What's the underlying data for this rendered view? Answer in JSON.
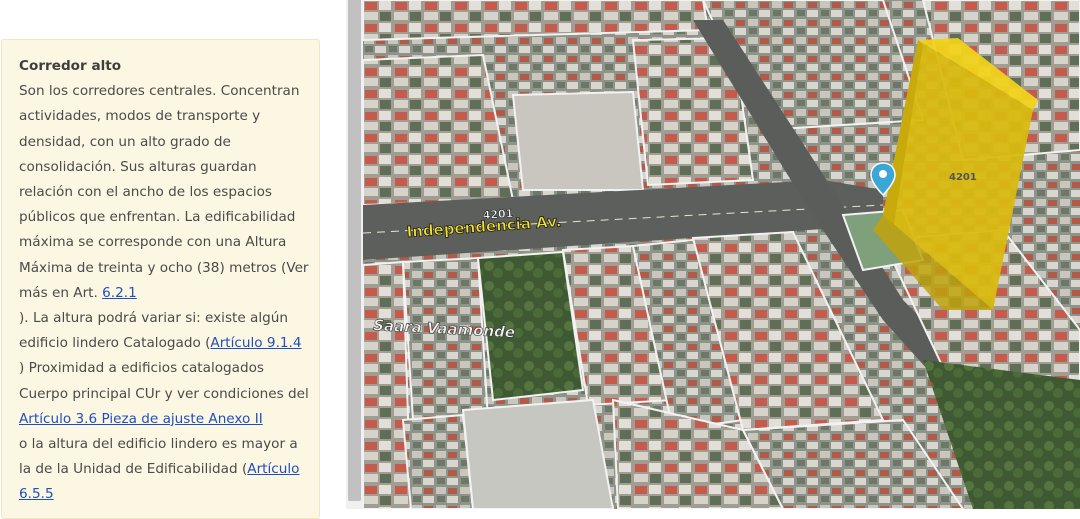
{
  "info_panel": {
    "title": "Corredor alto",
    "text_1": "Son los corredores centrales. Concentran actividades, modos de transporte y densidad, con un alto grado de consolidación. Sus alturas guardan relación con el ancho de los espacios públicos que enfrentan. La edificabilidad máxima se corresponde con una Altura Máxima de treinta y ocho (38) metros (Ver más en Art. ",
    "link_1": "6.2.1",
    "text_2": "). La altura podrá variar si: existe algún edificio lindero Catalogado (",
    "link_2": "Artículo 9.1.4",
    "text_3": ") Proximidad a edificios catalogados Cuerpo principal CUr y ver condiciones del ",
    "link_3": "Artículo 3.6 Pieza de ajuste Anexo II",
    "text_4": " o la altura del edificio lindero es mayor a la de la Unidad de Edificabilidad (",
    "link_4": "Artículo 6.5.5"
  },
  "map": {
    "street_main": "Independencia Av.",
    "street_main_number": "4201",
    "street_secondary": "Saara Vaamonde",
    "street_right_number": "4201",
    "building_color": "#e5c20e",
    "marker_color": "#3aa7d6"
  }
}
